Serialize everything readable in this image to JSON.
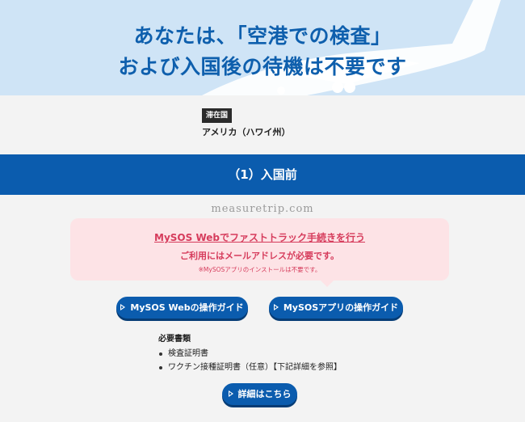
{
  "hero": {
    "line1": "あなたは、「空港での検査」",
    "line2": "および入国後の待機は不要です"
  },
  "country": {
    "badge": "滞在国",
    "name": "アメリカ（ハワイ州）"
  },
  "section": {
    "title": "（1）入国前"
  },
  "watermark": "measuretrip.com",
  "notice": {
    "link": "MySOS Webでファストトラック手続きを行う",
    "sub": "ご利用にはメールアドレスが必要です。",
    "note": "※MySOSアプリのインストールは不要です。"
  },
  "buttons": {
    "web_guide": "MySOS Webの操作ガイド",
    "app_guide": "MySOSアプリの操作ガイド",
    "details": "詳細はこちら"
  },
  "requirements": {
    "title": "必要書類",
    "items": [
      "検査証明書",
      "ワクチン接種証明書（任意）【下記詳細を参照】"
    ]
  },
  "colors": {
    "hero_bg": "#cfe4f6",
    "primary": "#0b5cae",
    "notice_bg": "#fde3e6",
    "notice_text": "#d63c5c"
  }
}
